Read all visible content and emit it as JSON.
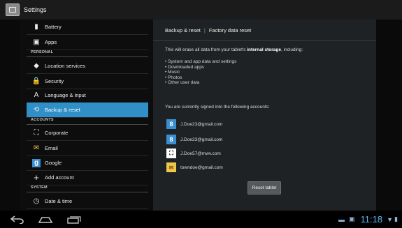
{
  "window": {
    "title": "Settings"
  },
  "settings_list": {
    "items": [
      {
        "label": "Battery",
        "icon": "battery-icon",
        "glyph": "▮"
      },
      {
        "label": "Apps",
        "icon": "apps-icon",
        "glyph": "▣"
      },
      {
        "label": "Location services",
        "icon": "location-icon",
        "glyph": "◆"
      },
      {
        "label": "Security",
        "icon": "lock-icon",
        "glyph": "🔒"
      },
      {
        "label": "Language & input",
        "icon": "keyboard-icon",
        "glyph": "A"
      },
      {
        "label": "Backup & reset",
        "icon": "backup-icon",
        "glyph": "⟲"
      },
      {
        "label": "Corporate",
        "icon": "corporate-icon",
        "glyph": "⛶"
      },
      {
        "label": "Email",
        "icon": "email-icon",
        "glyph": "✉"
      },
      {
        "label": "Google",
        "icon": "google-icon",
        "glyph": "g"
      },
      {
        "label": "Add account",
        "icon": "add-icon",
        "glyph": "+"
      },
      {
        "label": "Date & time",
        "icon": "clock-icon",
        "glyph": "◷"
      }
    ],
    "sections": [
      "PERSONAL",
      "ACCOUNTS",
      "SYSTEM"
    ],
    "active": "Backup & reset"
  },
  "detail": {
    "breadcrumb": [
      "Backup & reset",
      "Factory data reset"
    ],
    "message_before": "This will erase all data from your tablet's ",
    "message_bold": "internal storage",
    "message_after": ", including:",
    "bullets": [
      "System and app data and settings",
      "Downloaded apps",
      "Music",
      "Photos",
      "Other user data"
    ],
    "signed_in": "You are currently signed into the following accounts:",
    "accounts": [
      {
        "email": "J.Doe23@gmail.com",
        "icon": "google-account-icon",
        "glyph": "8"
      },
      {
        "email": "J.Doe23@gmail.com",
        "icon": "google-account-icon",
        "glyph": "8"
      },
      {
        "email": "J.Doe57@mwv.com",
        "icon": "corporate-account-icon",
        "glyph": "⛶"
      },
      {
        "email": "towndoe@gmail.com",
        "icon": "email-account-icon",
        "glyph": "✉"
      }
    ],
    "reset_button": "Reset tablet"
  },
  "system_bar": {
    "clock": "11:18",
    "nav": [
      "back",
      "home",
      "recent-apps"
    ]
  },
  "colors": {
    "accent": "#2f8fc6",
    "clock": "#57b6ee"
  }
}
